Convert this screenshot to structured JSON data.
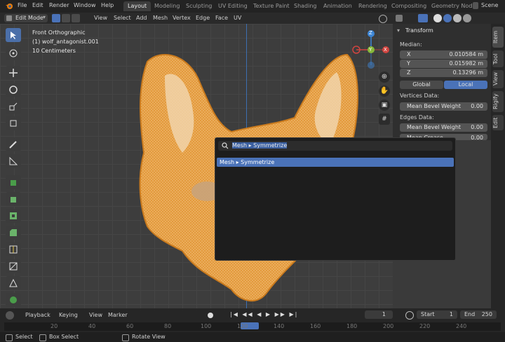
{
  "app": {
    "menus": [
      "File",
      "Edit",
      "Render",
      "Window",
      "Help"
    ],
    "workspaces": [
      "Layout",
      "Modeling",
      "Sculpting",
      "UV Editing",
      "Texture Paint",
      "Shading",
      "Animation",
      "Rendering",
      "Compositing",
      "Geometry Nod"
    ],
    "active_workspace": "Layout",
    "scene_label": "Scene"
  },
  "header": {
    "mode": "Edit Mode",
    "items": [
      "View",
      "Select",
      "Add",
      "Mesh",
      "Vertex",
      "Edge",
      "Face",
      "UV"
    ]
  },
  "viewport": {
    "view_name": "Front Orthographic",
    "object_name": "(1) wolf_antagonist.001",
    "scale_label": "10 Centimeters",
    "gizmo_axes": {
      "z": "Z",
      "x": "X",
      "y": "Y"
    }
  },
  "search_popup": {
    "query": "Mesh ▸ Symmetrize",
    "results": [
      "Mesh ▸ Symmetrize"
    ]
  },
  "npanel": {
    "section": "Transform",
    "median_label": "Median:",
    "fields": [
      {
        "label": "X",
        "value": "0.010584 m"
      },
      {
        "label": "Y",
        "value": "0.015982 m"
      },
      {
        "label": "Z",
        "value": "0.13296 m"
      }
    ],
    "toggle": {
      "global": "Global",
      "local": "Local",
      "active": "Local"
    },
    "vertices_label": "Vertices Data:",
    "vertex_bevel": {
      "label": "Mean Bevel Weight",
      "value": "0.00"
    },
    "edges_label": "Edges Data:",
    "edge_bevel": {
      "label": "Mean Bevel Weight",
      "value": "0.00"
    },
    "edge_crease": {
      "label": "Mean Crease",
      "value": "0.00"
    },
    "tabs": [
      "Item",
      "Tool",
      "View",
      "Rigify",
      "Edit"
    ]
  },
  "timeline": {
    "menus": [
      "Playback",
      "Keying",
      "View",
      "Marker"
    ],
    "current_frame": "1",
    "start_label": "Start",
    "start_value": "1",
    "end_label": "End",
    "end_value": "250",
    "ruler": [
      "20",
      "40",
      "60",
      "80",
      "100",
      "120",
      "140",
      "160",
      "180",
      "200",
      "220",
      "240"
    ]
  },
  "statusbar": {
    "items": [
      "Select",
      "Box Select",
      "Rotate View"
    ]
  },
  "colors": {
    "accent": "#4a72b8",
    "mesh": "#e7a04c",
    "axis_x": "#d0443f",
    "axis_y": "#86b83a",
    "axis_z": "#3d86d6"
  }
}
